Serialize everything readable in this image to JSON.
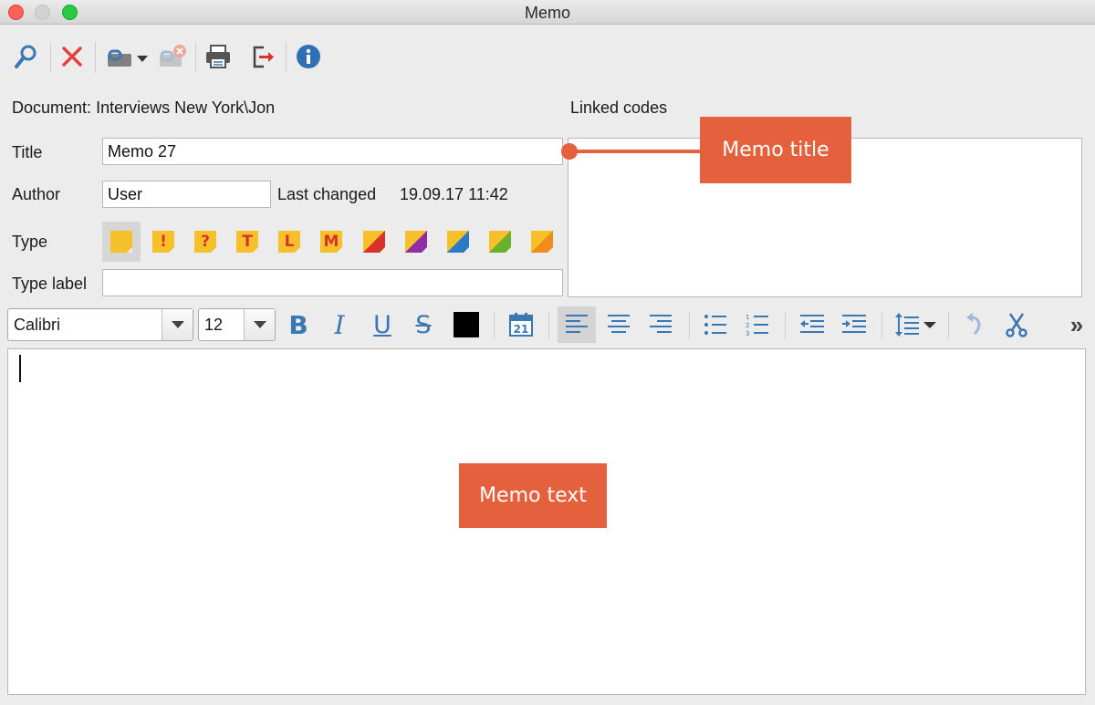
{
  "window": {
    "title": "Memo"
  },
  "toolbar": {
    "icons": [
      "search-icon",
      "delete-icon",
      "link-icon",
      "unlink-icon",
      "print-icon",
      "export-icon",
      "info-icon"
    ]
  },
  "document": {
    "label": "Document:",
    "value": "Interviews New York\\Jon"
  },
  "linked_codes": {
    "label": "Linked codes"
  },
  "title_field": {
    "label": "Title",
    "value": "Memo 27"
  },
  "author_field": {
    "label": "Author",
    "value": "User"
  },
  "last_changed": {
    "label": "Last changed",
    "value": "19.09.17 11:42"
  },
  "type_field": {
    "label": "Type",
    "options": [
      {
        "glyph": "",
        "color": "#f6c02a"
      },
      {
        "glyph": "!",
        "color": "#f6c02a"
      },
      {
        "glyph": "?",
        "color": "#f6c02a"
      },
      {
        "glyph": "T",
        "color": "#f6c02a"
      },
      {
        "glyph": "L",
        "color": "#f6c02a"
      },
      {
        "glyph": "M",
        "color": "#f6c02a"
      },
      {
        "glyph": "",
        "color": "#f6c02a",
        "corner": "#d8332a"
      },
      {
        "glyph": "",
        "color": "#f6c02a",
        "corner": "#8e2da5"
      },
      {
        "glyph": "",
        "color": "#f6c02a",
        "corner": "#2b79c9"
      },
      {
        "glyph": "",
        "color": "#f6c02a",
        "corner": "#6ab02b"
      },
      {
        "glyph": "",
        "color": "#f6c02a",
        "corner": "#f08c1a"
      }
    ]
  },
  "type_label_field": {
    "label": "Type label",
    "value": ""
  },
  "format_bar": {
    "font": "Calibri",
    "size": "12",
    "calendar_day": "21",
    "text_color": "#000000",
    "more": "»"
  },
  "callouts": {
    "memo_title": "Memo title",
    "memo_text": "Memo text"
  },
  "colors": {
    "accent": "#e5603c",
    "icon_blue": "#3a78b5",
    "delete_red": "#e0443e"
  }
}
